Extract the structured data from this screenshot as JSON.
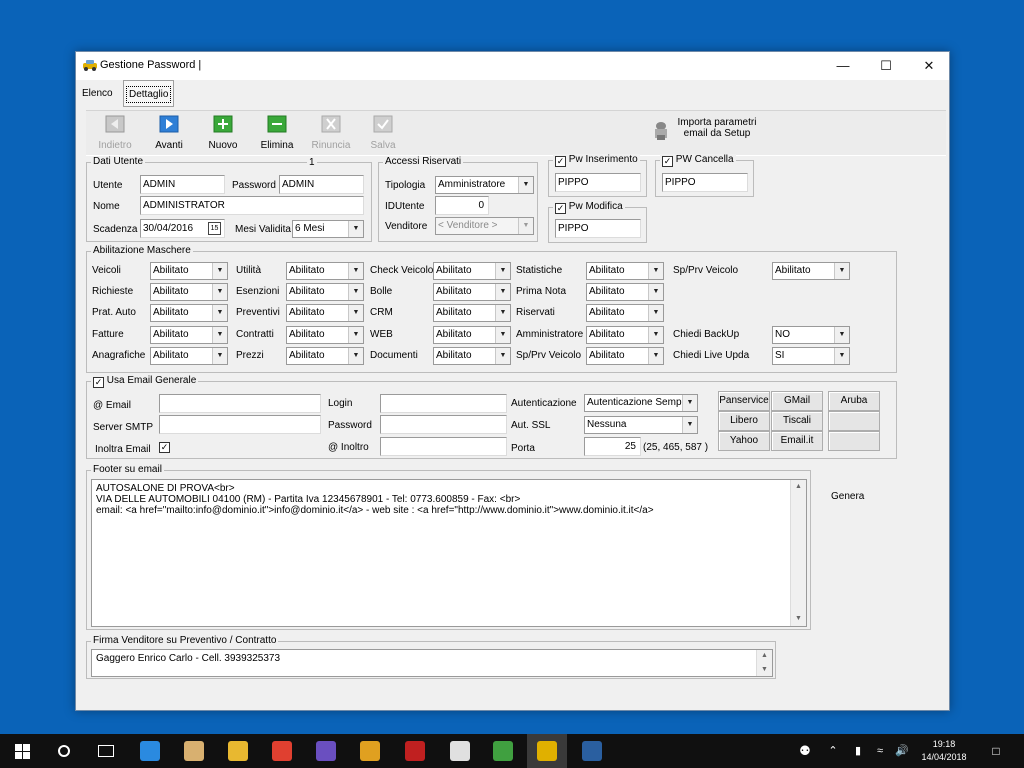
{
  "window": {
    "title": "Gestione Password |",
    "tabs": [
      "Elenco",
      "Dettaglio"
    ]
  },
  "toolbar": {
    "indietro": "Indietro",
    "avanti": "Avanti",
    "nuovo": "Nuovo",
    "elimina": "Elimina",
    "rinuncia": "Rinuncia",
    "salva": "Salva",
    "importa_line1": "Importa parametri",
    "importa_line2": "email da Setup"
  },
  "dati_utente": {
    "legend": "Dati Utente",
    "counter": "1",
    "utente_label": "Utente",
    "utente": "ADMIN",
    "password_label": "Password",
    "password": "ADMIN",
    "nome_label": "Nome",
    "nome": "ADMINISTRATOR",
    "scadenza_label": "Scadenza",
    "scadenza": "30/04/2016",
    "mesi_label": "Mesi Validita",
    "mesi": "6 Mesi"
  },
  "accessi": {
    "legend": "Accessi Riservati",
    "tipologia_label": "Tipologia",
    "tipologia": "Amministratore",
    "idutente_label": "IDUtente",
    "idutente": "0",
    "venditore_label": "Venditore",
    "venditore": "< Venditore >"
  },
  "pw": {
    "inserimento_label": "Pw Inserimento",
    "inserimento": "PIPPO",
    "cancella_label": "PW Cancella",
    "cancella": "PIPPO",
    "modifica_label": "Pw Modifica",
    "modifica": "PIPPO"
  },
  "abilitazione": {
    "legend": "Abilitazione Maschere",
    "col1": [
      {
        "label": "Veicoli",
        "value": "Abilitato"
      },
      {
        "label": "Richieste",
        "value": "Abilitato"
      },
      {
        "label": "Prat. Auto",
        "value": "Abilitato"
      },
      {
        "label": "Fatture",
        "value": "Abilitato"
      },
      {
        "label": "Anagrafiche",
        "value": "Abilitato"
      }
    ],
    "col2": [
      {
        "label": "Utilità",
        "value": "Abilitato"
      },
      {
        "label": "Esenzioni",
        "value": "Abilitato"
      },
      {
        "label": "Preventivi",
        "value": "Abilitato"
      },
      {
        "label": "Contratti",
        "value": "Abilitato"
      },
      {
        "label": "Prezzi",
        "value": "Abilitato"
      }
    ],
    "col3": [
      {
        "label": "Check Veicolo",
        "value": "Abilitato"
      },
      {
        "label": "Bolle",
        "value": "Abilitato"
      },
      {
        "label": "CRM",
        "value": "Abilitato"
      },
      {
        "label": "WEB",
        "value": "Abilitato"
      },
      {
        "label": "Documenti",
        "value": "Abilitato"
      }
    ],
    "col4": [
      {
        "label": "Statistiche",
        "value": "Abilitato"
      },
      {
        "label": "Prima Nota",
        "value": "Abilitato"
      },
      {
        "label": "Riservati",
        "value": "Abilitato"
      },
      {
        "label": "Amministratore",
        "value": "Abilitato"
      },
      {
        "label": "Sp/Prv Veicolo",
        "value": "Abilitato"
      }
    ],
    "sp_prv_label": "Sp/Prv Veicolo",
    "sp_prv": "Abilitato",
    "backup_label": "Chiedi BackUp",
    "backup": "NO",
    "live_label": "Chiedi Live Upda",
    "live": "SI"
  },
  "email": {
    "legend": "Usa Email Generale",
    "email_label": "@ Email",
    "email": "",
    "smtp_label": "Server SMTP",
    "smtp": "",
    "inoltra_label": "Inoltra Email",
    "login_label": "Login",
    "login": "",
    "password_label": "Password",
    "password": "",
    "inoltro_label": "@ Inoltro",
    "inoltro": "",
    "auth_label": "Autenticazione",
    "auth": "Autenticazione Semplic",
    "ssl_label": "Aut. SSL",
    "ssl": "Nessuna",
    "porta_label": "Porta",
    "porta": "25",
    "porta_hint": "(25, 465, 587 )",
    "providers": [
      "Panservice",
      "GMail",
      "Aruba",
      "Libero",
      "Tiscali",
      "Yahoo",
      "Email.it"
    ]
  },
  "footer": {
    "legend": "Footer su email",
    "line1": "AUTOSALONE DI PROVA<br>",
    "line2": "VIA DELLE AUTOMOBILI  04100 (RM) - Partita Iva 12345678901 - Tel: 0773.600859 - Fax: <br>",
    "line3": "email: <a href=\"mailto:info@dominio.it\">info@dominio.it</a> - web site : <a href=\"http://www.dominio.it\">www.dominio.it.it</a>",
    "genera": "Genera"
  },
  "firma": {
    "legend": "Firma Venditore su Preventivo  / Contratto",
    "text": "Gaggero Enrico Carlo - Cell. 3939325373"
  },
  "taskbar": {
    "time": "19:18",
    "date": "14/04/2018",
    "icons": [
      "windows-start-icon",
      "search-icon",
      "task-view-icon",
      "edge-icon",
      "file-manager-icon",
      "folder-icon",
      "chrome-icon",
      "visual-studio-icon",
      "media-icon",
      "filezilla-icon",
      "seven-zip-icon",
      "puzzle-app-icon",
      "car-app-icon",
      "photoshop-icon"
    ]
  }
}
